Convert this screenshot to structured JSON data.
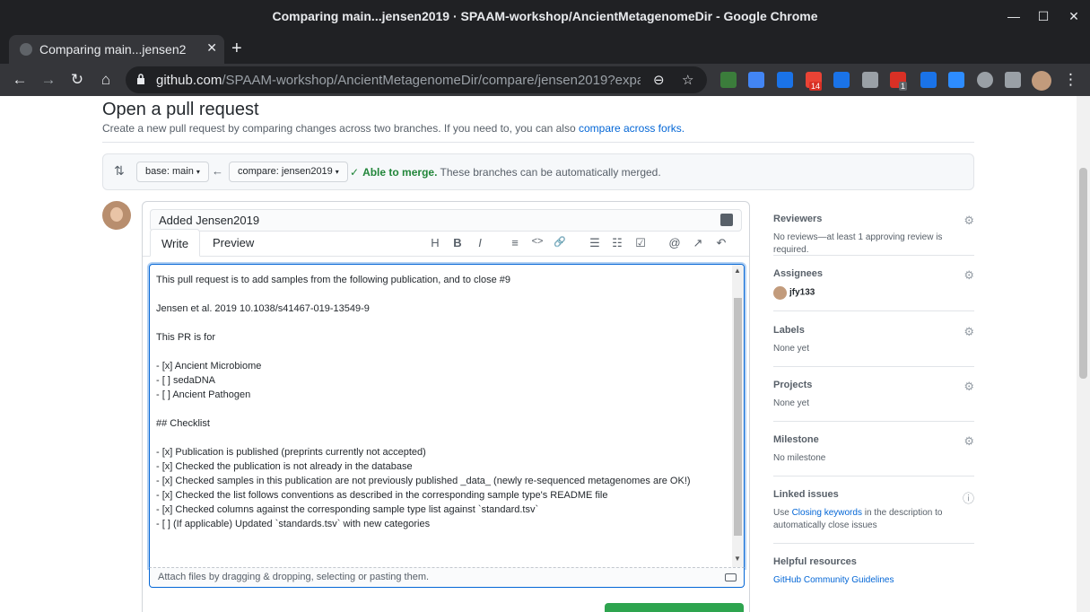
{
  "window": {
    "title": "Comparing main...jensen2019 · SPAAM-workshop/AncientMetagenomeDir - Google Chrome",
    "minimize": "—",
    "maximize": "☐",
    "close": "✕"
  },
  "tab": {
    "title": "Comparing main...jensen2",
    "close": "✕",
    "new": "+"
  },
  "toolbar": {
    "back": "←",
    "forward": "→",
    "reload": "↻",
    "home": "⌂",
    "url_host": "github.com",
    "url_path": "/SPAAM-workshop/AncientMetagenomeDir/compare/jensen2019?expa...",
    "zoom": "⊖",
    "star": "☆",
    "badge1": "14",
    "badge2": "1",
    "menu": "⋮"
  },
  "page": {
    "title": "Open a pull request",
    "subtitle": "Create a new pull request by comparing changes across two branches. If you need to, you can also",
    "subtitle_link": "compare across forks.",
    "base_label": "base: main",
    "compare_label": "compare: jensen2019",
    "caret": "▾",
    "arrow": "←",
    "compare_icon": "⇅",
    "check": "✓",
    "merge_ok": "Able to merge.",
    "merge_text": "These branches can be automatically merged."
  },
  "form": {
    "title_value": "Added Jensen2019",
    "tab_write": "Write",
    "tab_preview": "Preview",
    "toolbar_icons": {
      "heading": "H",
      "bold": "B",
      "italic": "I",
      "quote": "≡",
      "code": "<>",
      "link": "🔗",
      "ul": "☰",
      "ol": "☷",
      "task": "☑",
      "mention": "@",
      "reference": "↗",
      "reply": "↶"
    },
    "body_lines": [
      "This pull request is to add samples from the following publication, and to close #9",
      "",
      "Jensen et al. 2019 10.1038/s41467-019-13549-9",
      "",
      "This PR is for",
      "",
      "- [x] Ancient Microbiome",
      "- [ ] sedaDNA",
      "- [ ] Ancient Pathogen",
      "",
      "## Checklist",
      "",
      "- [x] Publication is published (preprints currently not accepted)",
      "- [x] Checked the publication is not already in the database",
      "- [x] Checked samples in this publication are not previously published _data_ (newly re-sequenced metagenomes are OK!)",
      "- [x] Checked the list follows conventions as described in the corresponding sample type's README file",
      "- [x] Checked columns against the corresponding sample type list against `standard.tsv`",
      "- [ ] (If applicable) Updated `standards.tsv` with new categories"
    ],
    "attach_text": "Attach files by dragging & dropping, selecting or pasting them.",
    "scroll_up": "▲",
    "scroll_down": "▼"
  },
  "sidebar": {
    "gear": "⚙",
    "info": "ⓘ",
    "reviewers_title": "Reviewers",
    "reviewers_value": "No reviews—at least 1 approving review is required.",
    "assignees_title": "Assignees",
    "assignee_name": "jfy133",
    "labels_title": "Labels",
    "labels_value": "None yet",
    "projects_title": "Projects",
    "projects_value": "None yet",
    "milestone_title": "Milestone",
    "milestone_value": "No milestone",
    "linked_title": "Linked issues",
    "linked_pre": "Use",
    "linked_link": "Closing keywords",
    "linked_post": "in the description to automatically close issues",
    "helpful_title": "Helpful resources",
    "helpful_link": "GitHub Community Guidelines"
  },
  "colors": {
    "accent": "#0366d6",
    "success": "#22863a",
    "button_green": "#2ea44f"
  }
}
